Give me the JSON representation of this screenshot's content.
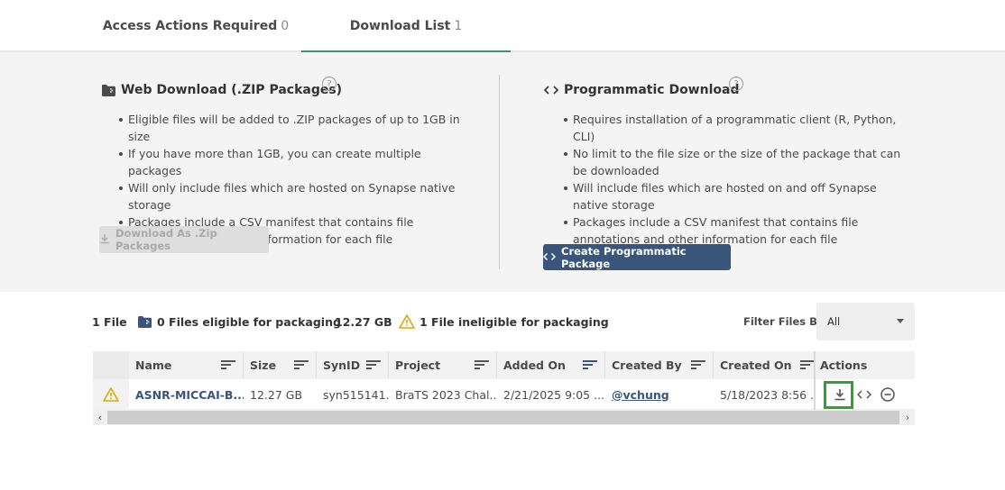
{
  "tabs": [
    {
      "label": "Access Actions Required",
      "count": "0"
    },
    {
      "label": "Download List",
      "count": "1"
    }
  ],
  "web_download": {
    "title": "Web Download (.ZIP Packages)",
    "bullets": [
      "Eligible files will be added to .ZIP packages of up to 1GB in size",
      "If you have more than 1GB, you can create multiple packages",
      "Will only include files which are hosted on Synapse native storage",
      "Packages include a CSV manifest that contains file annotations and other information for each file"
    ],
    "button_label": "Download As .Zip Packages",
    "button_state": "disabled"
  },
  "programmatic_download": {
    "title": "Programmatic Download",
    "bullets": [
      "Requires installation of a programmatic client (R, Python, CLI)",
      "No limit to the file size or the size of the package that can be downloaded",
      "Will include files which are hosted on and off Synapse native storage",
      "Packages include a CSV manifest that contains file annotations and other information for each file"
    ],
    "button_label": "Create Programmatic Package"
  },
  "summary": {
    "file_count": "1 File",
    "eligible": "0 Files eligible for packaging",
    "size": "12.27 GB",
    "ineligible": "1 File ineligible for packaging",
    "filter_label": "Filter Files By",
    "filter_value": "All"
  },
  "table": {
    "columns": [
      "Name",
      "Size",
      "SynID",
      "Project",
      "Added On",
      "Created By",
      "Created On",
      "Actions"
    ],
    "rows": [
      {
        "name": "ASNR-MICCAI-B...",
        "size": "12.27 GB",
        "synid": "syn515141...",
        "project": "BraTS 2023 Chal...",
        "added_on": "2/21/2025 9:05 ...",
        "created_by": "@vchung",
        "created_on": "5/18/2023 8:56 ..."
      }
    ]
  },
  "colors": {
    "accent": "#3d8f7a",
    "primary_button": "#395579",
    "warning": "#e0a800",
    "highlight": "#2aa52e"
  },
  "icons": {
    "web_download": "folder-zip-icon",
    "programmatic": "code-icon",
    "help": "help-circle-icon",
    "warning": "warning-icon",
    "download": "download-icon",
    "remove": "remove-circle-icon"
  }
}
